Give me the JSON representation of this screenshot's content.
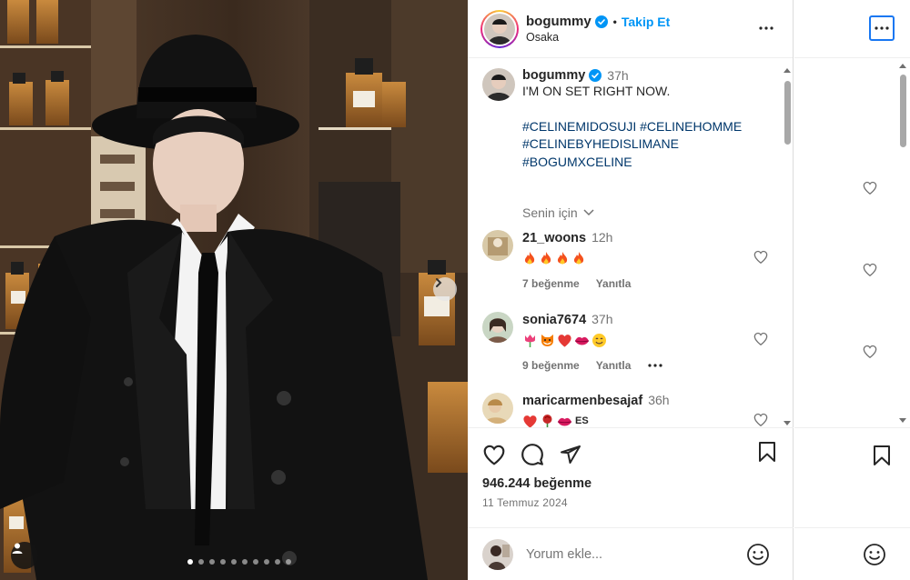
{
  "photo": {
    "alt": "",
    "slide_count": 10,
    "active_slide": 0
  },
  "header": {
    "username": "bogummy",
    "bullet": "•",
    "follow_label": "Takip Et",
    "location": "Osaka"
  },
  "caption": {
    "username": "bogummy",
    "time": "37h",
    "text": "I'M ON SET RIGHT NOW.",
    "hashtags": [
      "#CELINEMIDOSUJI #CELINEHOMME",
      "#CELINEBYHEDISLIMANE",
      "#BOGUMXCELINE"
    ],
    "translation_label": "Senin için"
  },
  "comments": [
    {
      "username": "21_woons",
      "time": "12h",
      "emojis": [
        "fire-emoji",
        "fire-emoji",
        "fire-emoji",
        "fire-emoji"
      ],
      "likes": "7 beğenme",
      "reply": "Yanıtla"
    },
    {
      "username": "sonia7674",
      "time": "37h",
      "emojis": [
        "tulip-emoji",
        "fox-emoji",
        "red-heart-emoji",
        "kiss-mark-emoji",
        "smiling-face-emoji"
      ],
      "likes": "9 beğenme",
      "reply": "Yanıtla"
    },
    {
      "username": "maricarmenbesajaf",
      "time": "36h",
      "emojis": [
        "red-heart-emoji",
        "rose-emoji",
        "kiss-mark-emoji"
      ],
      "emoji_suffix": "ES"
    }
  ],
  "actions": {
    "likes": "946.244 beğenme",
    "date": "11 Temmuz 2024"
  },
  "add_comment": {
    "placeholder": "Yorum ekle..."
  },
  "colors": {
    "accent_blue": "#0095f6",
    "hashtag": "#00376b",
    "secondary_text": "#737373",
    "primary_text": "#262626",
    "verified": "#0095f6"
  }
}
